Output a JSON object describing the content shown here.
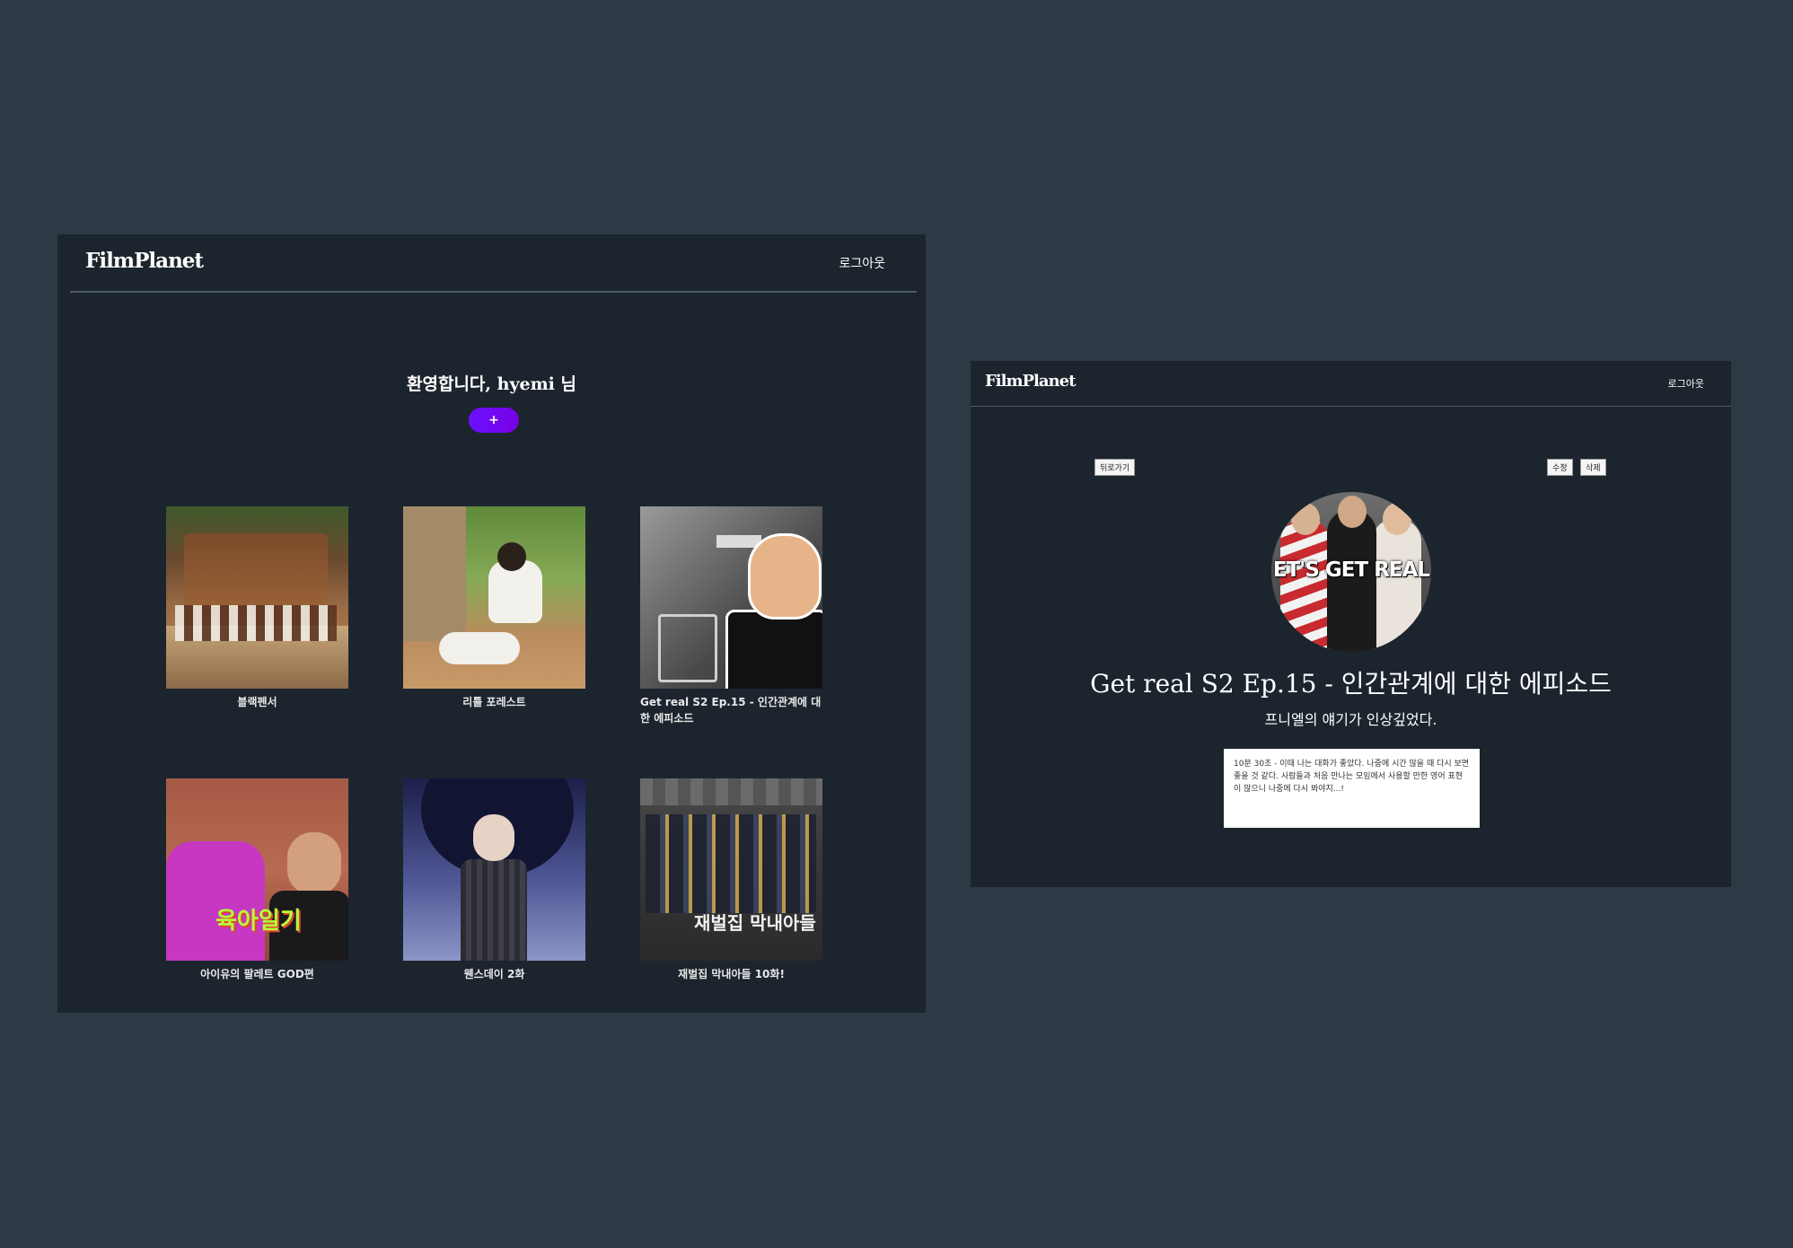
{
  "list_page": {
    "header": {
      "logo": "FilmPlanet",
      "logout_label": "로그아웃"
    },
    "welcome_text": "환영합니다, hyemi 님",
    "add_button_label": "+",
    "cards": [
      {
        "title": "블랙펜서"
      },
      {
        "title": "리틀 포레스트"
      },
      {
        "title": "Get real S2 Ep.15 - 인간관계에 대한 에피소드"
      },
      {
        "title": "아이유의 팔레트 GOD편",
        "thumb_text": "육아일기"
      },
      {
        "title": "웬스데이 2화"
      },
      {
        "title": "재벌집 막내아들 10화!",
        "thumb_text": "재벌집 막내아들"
      }
    ]
  },
  "detail_page": {
    "header": {
      "logo": "FilmPlanet",
      "logout_label": "로그아웃"
    },
    "back_label": "뒤로가기",
    "edit_label": "수정",
    "delete_label": "삭제",
    "image_text": "ET'S GET REAL",
    "title": "Get real S2 Ep.15 - 인간관계에 대한 에피소드",
    "subtitle": "프니엘의 얘기가 인상깊었다.",
    "note": "10분 30초 - 이때 나는 대화가 좋았다. 나중에 시간 많을 때 다시 보면 좋을 것 같다. 사람들과 처음 만나는 모임에서 사용할 만한 영어 표현이 많으니 나중에 다시 봐야지...!"
  },
  "colors": {
    "background": "#2d3a46",
    "panel": "#1c252e",
    "accent": "#6a10ff"
  }
}
